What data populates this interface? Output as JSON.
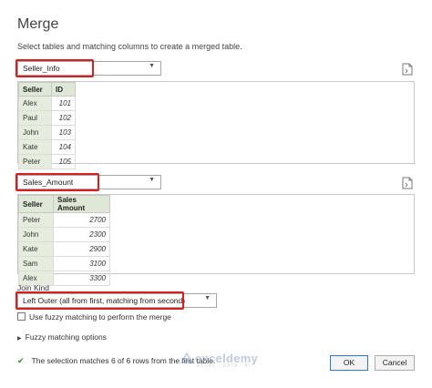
{
  "dialog": {
    "title": "Merge",
    "subtitle": "Select tables and matching columns to create a merged table."
  },
  "table1": {
    "selected": "Seller_Info",
    "columns": [
      "Seller",
      "ID"
    ],
    "rows": [
      [
        "Alex",
        "101"
      ],
      [
        "Paul",
        "102"
      ],
      [
        "John",
        "103"
      ],
      [
        "Kate",
        "104"
      ],
      [
        "Peter",
        "105"
      ]
    ]
  },
  "table2": {
    "selected": "Sales_Amount",
    "columns": [
      "Seller",
      "Sales Amount"
    ],
    "rows": [
      [
        "Peter",
        "2700"
      ],
      [
        "John",
        "2300"
      ],
      [
        "Kate",
        "2900"
      ],
      [
        "Sam",
        "3100"
      ],
      [
        "Alex",
        "3300"
      ]
    ]
  },
  "join": {
    "label": "Join Kind",
    "selected": "Left Outer (all from first, matching from second)"
  },
  "fuzzy": {
    "checkbox_label": "Use fuzzy matching to perform the merge",
    "checked": false,
    "options_label": "Fuzzy matching options"
  },
  "status": {
    "text": "The selection matches 6 of 6 rows from the first table."
  },
  "buttons": {
    "ok": "OK",
    "cancel": "Cancel"
  },
  "watermark": {
    "name": "exceldemy",
    "tagline": "EXCEL · DATA · BI"
  },
  "colors": {
    "highlight": "#d91e1e",
    "header_bg": "#dfe8d6",
    "ok_border": "#2b79d3",
    "check": "#3a8d2f"
  }
}
